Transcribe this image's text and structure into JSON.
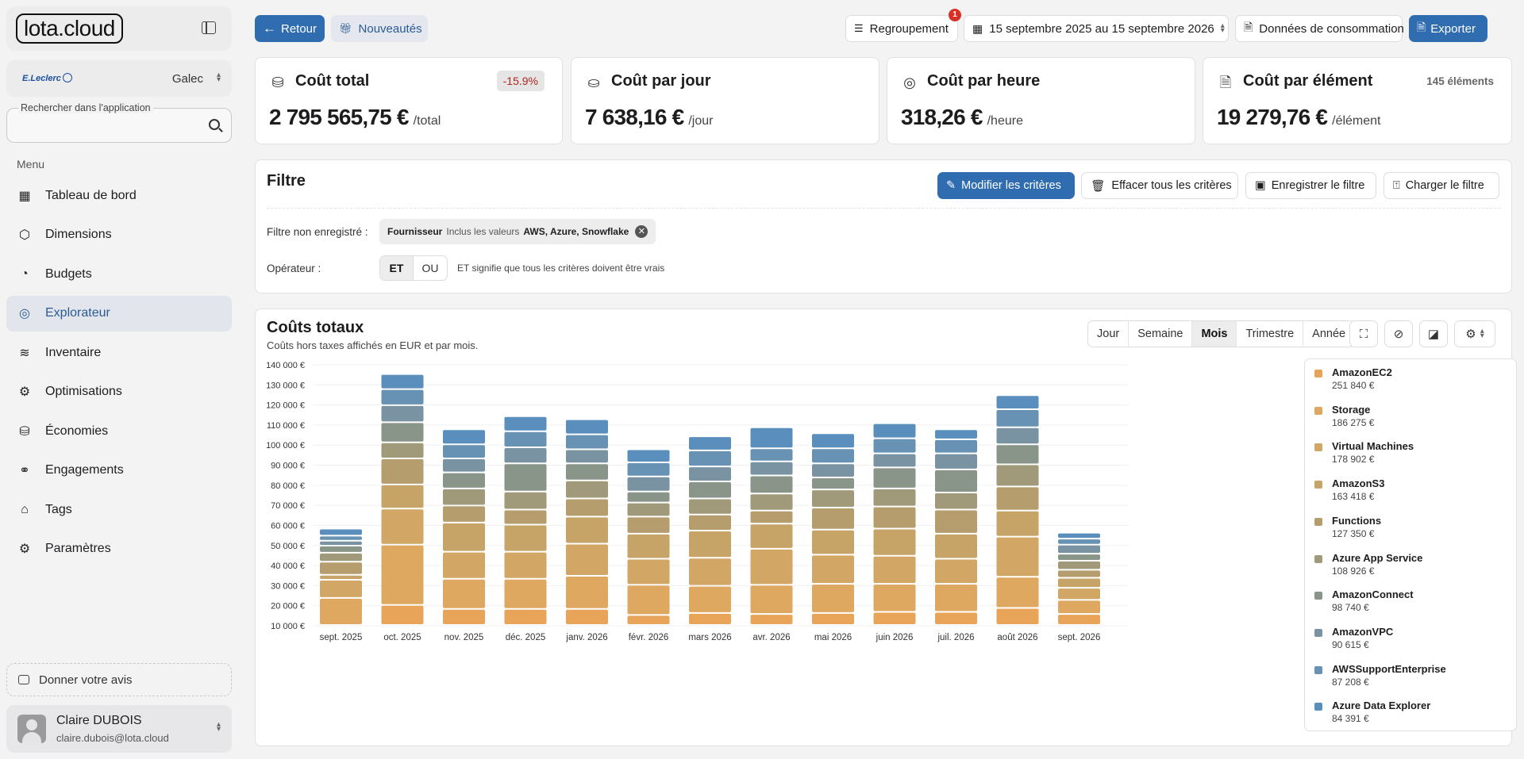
{
  "app": {
    "logo": "lota.cloud"
  },
  "org": {
    "logo_text": "E.Leclerc",
    "name": "Galec"
  },
  "search": {
    "label": "Rechercher dans l'application",
    "placeholder": ""
  },
  "menu": {
    "title": "Menu",
    "items": [
      {
        "label": "Tableau de bord",
        "icon": "dashboard-icon"
      },
      {
        "label": "Dimensions",
        "icon": "cube-icon"
      },
      {
        "label": "Budgets",
        "icon": "budget-icon"
      },
      {
        "label": "Explorateur",
        "icon": "binoculars-icon",
        "active": true
      },
      {
        "label": "Inventaire",
        "icon": "layers-icon"
      },
      {
        "label": "Optimisations",
        "icon": "optimisation-icon"
      },
      {
        "label": "Économies",
        "icon": "savings-icon"
      },
      {
        "label": "Engagements",
        "icon": "handshake-icon"
      },
      {
        "label": "Tags",
        "icon": "tag-icon"
      },
      {
        "label": "Paramètres",
        "icon": "gear-icon"
      }
    ]
  },
  "feedback": {
    "label": "Donner votre avis"
  },
  "user": {
    "name": "Claire DUBOIS",
    "email": "claire.dubois@lota.cloud"
  },
  "toolbar": {
    "back_label": "Retour",
    "news_label": "Nouveautés",
    "grouping_label": "Regroupement",
    "grouping_badge": "1",
    "date_range": "15 septembre 2025 au 15 septembre 2026",
    "dataset": "Données de consommation",
    "export_label": "Exporter"
  },
  "kpis": [
    {
      "title": "Coût total",
      "value": "2 795 565,75 €",
      "unit": "/total",
      "badge": "-15.9%"
    },
    {
      "title": "Coût par jour",
      "value": "7 638,16 €",
      "unit": "/jour"
    },
    {
      "title": "Coût par heure",
      "value": "318,26 €",
      "unit": "/heure"
    },
    {
      "title": "Coût par élément",
      "value": "19 279,76 €",
      "unit": "/élément",
      "count": "145 éléments"
    }
  ],
  "filter": {
    "title": "Filtre",
    "edit_label": "Modifier les critères",
    "clear_label": "Effacer tous les critères",
    "save_label": "Enregistrer le filtre",
    "load_label": "Charger le filtre",
    "unsaved_label": "Filtre non enregistré :",
    "chip_field": "Fournisseur",
    "chip_op": "Inclus les valeurs",
    "chip_values": "AWS, Azure, Snowflake",
    "operator_label": "Opérateur :",
    "op_and": "ET",
    "op_or": "OU",
    "op_hint": "ET signifie que tous les critères doivent être vrais"
  },
  "chart_panel": {
    "title": "Coûts totaux",
    "subtitle": "Coûts hors taxes affichés en EUR et par mois.",
    "periods": [
      "Jour",
      "Semaine",
      "Mois",
      "Trimestre",
      "Année"
    ],
    "selected_period": "Mois"
  },
  "colors": {
    "primary": "#2f6db0",
    "badge_red": "#d93025"
  },
  "chart_data": {
    "type": "bar",
    "stacked": true,
    "categories": [
      "sept. 2025",
      "oct. 2025",
      "nov. 2025",
      "déc. 2025",
      "janv. 2026",
      "févr. 2026",
      "mars 2026",
      "avr. 2026",
      "mai 2026",
      "juin 2026",
      "juil. 2026",
      "août 2026",
      "sept. 2026"
    ],
    "ylim": [
      10000,
      140000
    ],
    "yticks": [
      10000,
      20000,
      30000,
      40000,
      50000,
      60000,
      70000,
      80000,
      90000,
      100000,
      110000,
      120000,
      130000,
      140000
    ],
    "ytick_labels": [
      "10 000 €",
      "20 000 €",
      "30 000 €",
      "40 000 €",
      "50 000 €",
      "60 000 €",
      "70 000 €",
      "80 000 €",
      "90 000 €",
      "100 000 €",
      "110 000 €",
      "120 000 €",
      "130 000 €",
      "140 000 €"
    ],
    "grid": true,
    "legend_position": "right",
    "series": [
      {
        "name": "AmazonEC2",
        "total_label": "251 840 €",
        "color": "#e8a55a",
        "values": [
          0,
          10000,
          8000,
          8000,
          8000,
          5000,
          6000,
          5500,
          6000,
          6500,
          6500,
          8500,
          5500
        ]
      },
      {
        "name": "Storage",
        "total_label": "186 275 €",
        "color": "#dea861",
        "values": [
          13500,
          30000,
          15000,
          15000,
          16500,
          15000,
          13500,
          14500,
          14500,
          14000,
          14000,
          15500,
          7000
        ]
      },
      {
        "name": "Virtual Machines",
        "total_label": "178 902 €",
        "color": "#d2a664",
        "values": [
          9000,
          18000,
          13500,
          13500,
          16000,
          13000,
          14000,
          18000,
          14500,
          14000,
          12500,
          20000,
          6000
        ]
      },
      {
        "name": "AmazonS3",
        "total_label": "163 418 €",
        "color": "#c6a367",
        "values": [
          2500,
          12000,
          14500,
          13500,
          13500,
          12500,
          13500,
          12500,
          12500,
          13500,
          12500,
          13000,
          5000
        ]
      },
      {
        "name": "Functions",
        "total_label": "127 350 €",
        "color": "#b59d6e",
        "values": [
          6500,
          13000,
          8500,
          7500,
          9000,
          8500,
          8000,
          6500,
          11000,
          11000,
          12000,
          12000,
          4000
        ]
      },
      {
        "name": "Azure App Service",
        "total_label": "108 926 €",
        "color": "#a09a7a",
        "values": [
          4500,
          8000,
          8500,
          9000,
          9000,
          7000,
          8000,
          8500,
          9000,
          9000,
          8500,
          11000,
          4500
        ]
      },
      {
        "name": "AmazonConnect",
        "total_label": "98 740 €",
        "color": "#8a958a",
        "values": [
          3500,
          10000,
          8000,
          14000,
          8500,
          5500,
          8500,
          9000,
          6000,
          10500,
          11500,
          10000,
          3500
        ]
      },
      {
        "name": "AmazonVPC",
        "total_label": "90 615 €",
        "color": "#7a93a3",
        "values": [
          2500,
          8500,
          7000,
          8000,
          7000,
          7500,
          7500,
          7000,
          7000,
          7000,
          8000,
          8500,
          4500
        ]
      },
      {
        "name": "AWSSupportEnterprise",
        "total_label": "87 208 €",
        "color": "#6892b3",
        "values": [
          2500,
          8000,
          7000,
          8000,
          7500,
          7000,
          8000,
          6500,
          7500,
          7500,
          7000,
          9000,
          3000
        ]
      },
      {
        "name": "Azure Data Explorer",
        "total_label": "84 391 €",
        "color": "#5a8fbd",
        "values": [
          3500,
          7500,
          7500,
          7500,
          7500,
          6500,
          7000,
          10500,
          7500,
          7500,
          5000,
          7000,
          3000
        ]
      }
    ]
  }
}
